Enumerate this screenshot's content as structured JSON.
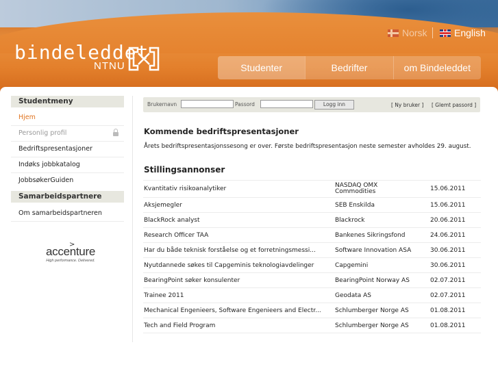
{
  "header": {
    "logo_text": "bindeleddet",
    "logo_sub": "NTNU",
    "lang_norsk": "Norsk",
    "lang_english": "English",
    "nav": [
      "Studenter",
      "Bedrifter",
      "om Bindeleddet"
    ]
  },
  "sidebar": {
    "menu_title": "Studentmeny",
    "items": [
      "Hjem",
      "Personlig profil",
      "Bedriftspresentasjoner",
      "Indøks jobbkatalog",
      "JobbsøkerGuiden"
    ],
    "partners_title": "Samarbeidspartnere",
    "partners_items": [
      "Om samarbeidspartneren"
    ],
    "sponsor_name": "accenture",
    "sponsor_tagline": "High performance. Delivered."
  },
  "login": {
    "username_label": "Brukernavn",
    "password_label": "Passord",
    "login_button": "Logg inn",
    "new_user": "[ Ny bruker ]",
    "forgot_password": "[ Glemt passord ]"
  },
  "main": {
    "presentations_title": "Kommende bedriftspresentasjoner",
    "presentations_text": "Årets bedriftspresentasjonssesong er over. Første bedriftspresentasjon neste semester avholdes 29. august.",
    "jobs_title": "Stillingsannonser",
    "jobs": [
      {
        "title": "Kvantitativ risikoanalytiker",
        "company": "NASDAQ OMX Commodities",
        "date": "15.06.2011"
      },
      {
        "title": "Aksjemegler",
        "company": "SEB Enskilda",
        "date": "15.06.2011"
      },
      {
        "title": "BlackRock analyst",
        "company": "Blackrock",
        "date": "20.06.2011"
      },
      {
        "title": "Research Officer TAA",
        "company": "Bankenes Sikringsfond",
        "date": "24.06.2011"
      },
      {
        "title": "Har du både teknisk forståelse og et forretningsmessi...",
        "company": "Software Innovation ASA",
        "date": "30.06.2011"
      },
      {
        "title": "Nyutdannede søkes til Capgeminis teknologiavdelinger",
        "company": "Capgemini",
        "date": "30.06.2011"
      },
      {
        "title": "BearingPoint søker konsulenter",
        "company": "BearingPoint Norway AS",
        "date": "02.07.2011"
      },
      {
        "title": "Trainee 2011",
        "company": "Geodata AS",
        "date": "02.07.2011"
      },
      {
        "title": "Mechanical Engenieers, Software Engenieers and Electr...",
        "company": "Schlumberger Norge AS",
        "date": "01.08.2011"
      },
      {
        "title": "Tech and Field Program",
        "company": "Schlumberger Norge AS",
        "date": "01.08.2011"
      }
    ]
  },
  "colors": {
    "accent": "#e0731e",
    "header_orange": "#e5832f"
  }
}
